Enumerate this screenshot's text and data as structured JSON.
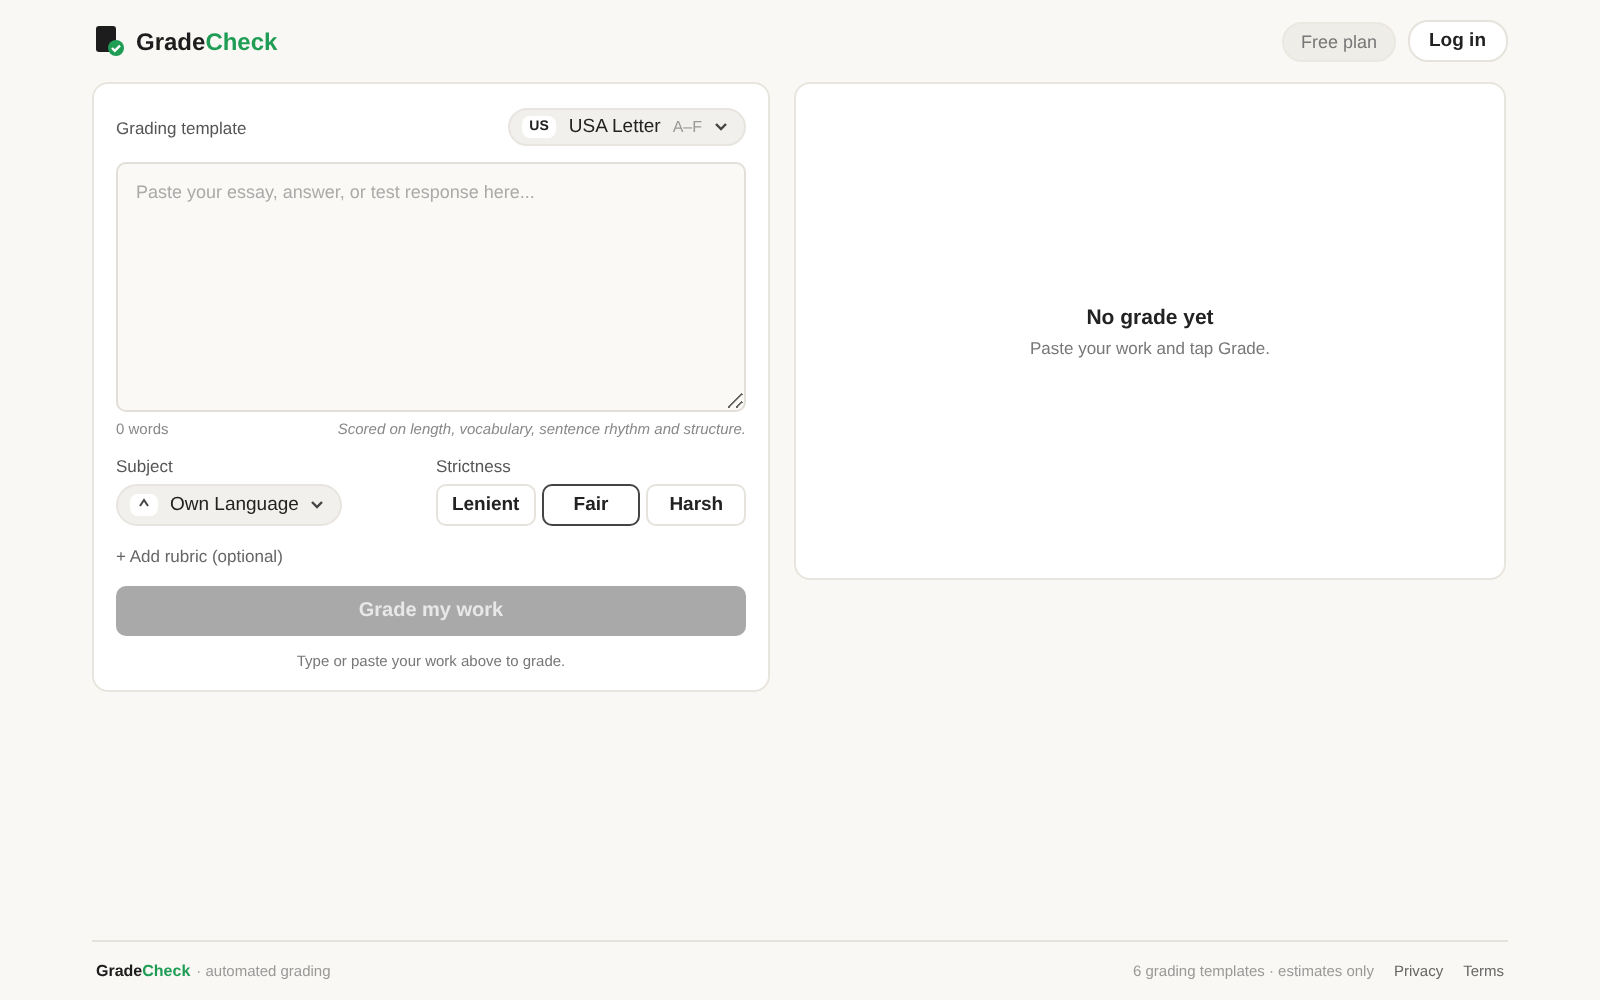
{
  "header": {
    "brand": {
      "first": "Grade",
      "second": "Check"
    },
    "plan_badge": "Free plan",
    "login_button": "Log in"
  },
  "form": {
    "template_label": "Grading template",
    "template": {
      "code": "US",
      "name": "USA Letter",
      "scale": "A–F"
    },
    "essay": {
      "placeholder": "Paste your essay, answer, or test response here..."
    },
    "word_count": "0 words",
    "scoring_note": "Scored on length, vocabulary, sentence rhythm and structure.",
    "subject_label": "Subject",
    "subject": {
      "name": "Own Language"
    },
    "strictness_label": "Strictness",
    "strictness": [
      {
        "label": "Lenient",
        "selected": false
      },
      {
        "label": "Fair",
        "selected": true
      },
      {
        "label": "Harsh",
        "selected": false
      }
    ],
    "add_rubric": "+ Add rubric (optional)",
    "grade_button": {
      "label": "Grade my work",
      "disabled": true
    },
    "hint": "Type or paste your work above to grade."
  },
  "result": {
    "title": "No grade yet",
    "subtitle": "Paste your work and tap Grade."
  },
  "footer": {
    "brand": {
      "first": "Grade",
      "second": "Check"
    },
    "tagline": "· automated grading",
    "note": "6 grading templates · estimates only",
    "links": [
      "Privacy",
      "Terms"
    ]
  }
}
